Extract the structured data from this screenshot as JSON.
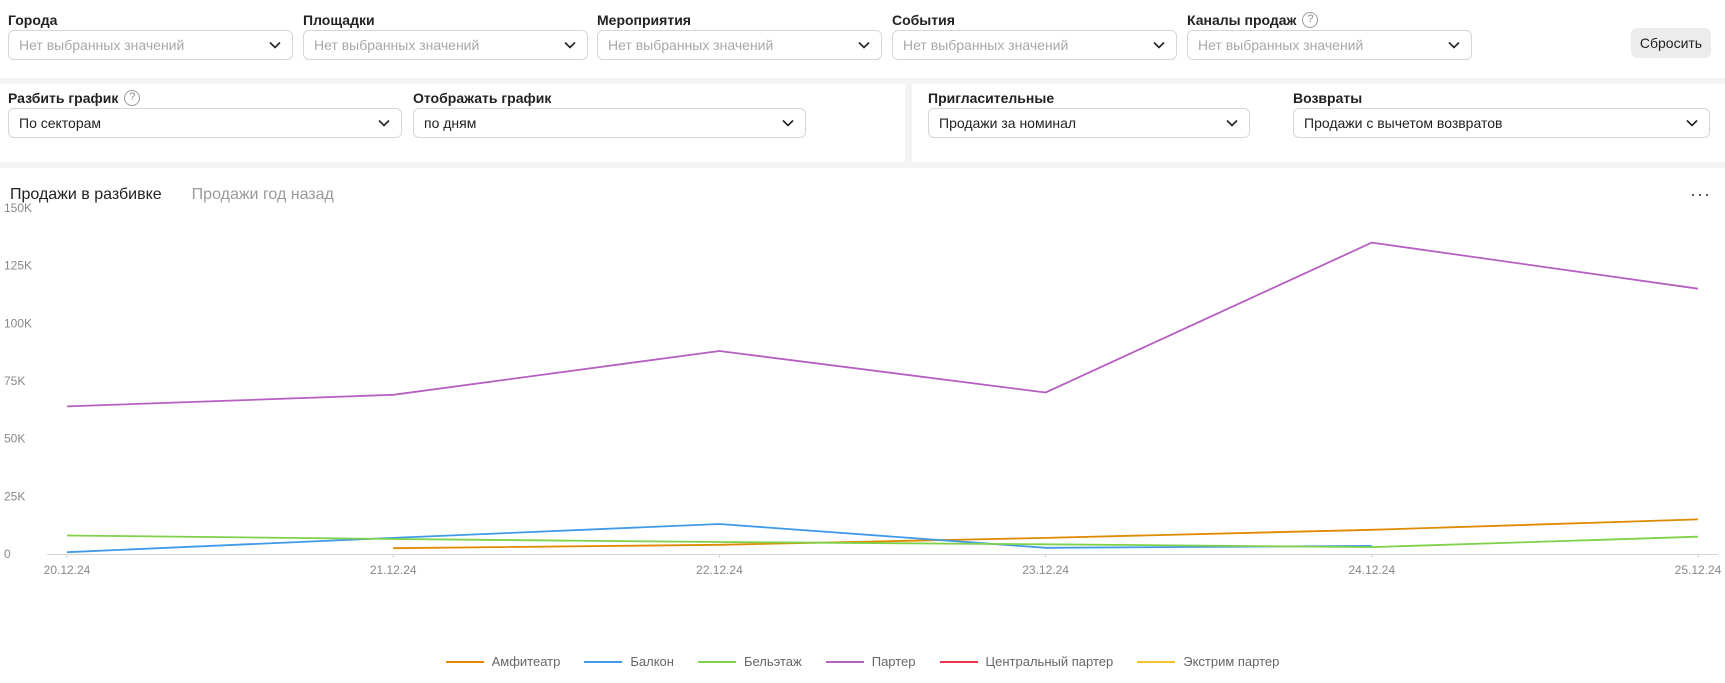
{
  "filters_top": [
    {
      "label": "Города",
      "value": "Нет выбранных значений",
      "help": false
    },
    {
      "label": "Площадки",
      "value": "Нет выбранных значений",
      "help": false
    },
    {
      "label": "Мероприятия",
      "value": "Нет выбранных значений",
      "help": false
    },
    {
      "label": "События",
      "value": "Нет выбранных значений",
      "help": false
    },
    {
      "label": "Каналы продаж",
      "value": "Нет выбранных значений",
      "help": true
    }
  ],
  "reset_label": "Сбросить",
  "split": {
    "label": "Разбить график",
    "value": "По секторам"
  },
  "display": {
    "label": "Отображать график",
    "value": "по дням"
  },
  "invites": {
    "label": "Пригласительные",
    "value": "Продажи за номинал"
  },
  "returns": {
    "label": "Возвраты",
    "value": "Продажи с вычетом возвратов"
  },
  "tabs": [
    "Продажи в разбивке",
    "Продажи год назад"
  ],
  "help_glyph": "?",
  "more_glyph": "···",
  "chart_data": {
    "type": "line",
    "x": [
      "20.12.24",
      "21.12.24",
      "22.12.24",
      "23.12.24",
      "24.12.24",
      "25.12.24"
    ],
    "y_ticks": [
      "0",
      "25K",
      "50K",
      "75K",
      "100K",
      "125K",
      "150K"
    ],
    "ylim": [
      0,
      150000
    ],
    "series": [
      {
        "name": "Амфитеатр",
        "color": "#e08a00",
        "values": [
          null,
          2500,
          4000,
          7000,
          10500,
          15000
        ]
      },
      {
        "name": "Балкон",
        "color": "#3f9ae8",
        "values": [
          800,
          7000,
          13000,
          2700,
          3500,
          null
        ]
      },
      {
        "name": "Бельэтаж",
        "color": "#7fd14a",
        "values": [
          8000,
          6500,
          5200,
          4200,
          3000,
          7500
        ]
      },
      {
        "name": "Партер",
        "color": "#b660c1",
        "values": [
          64000,
          69000,
          88000,
          70000,
          135000,
          115000
        ]
      },
      {
        "name": "Центральный партер",
        "color": "#f0334a",
        "values": [
          null,
          null,
          null,
          null,
          null,
          null
        ]
      },
      {
        "name": "Экстрим партер",
        "color": "#f5c32a",
        "values": [
          null,
          null,
          null,
          null,
          null,
          null
        ]
      }
    ]
  }
}
